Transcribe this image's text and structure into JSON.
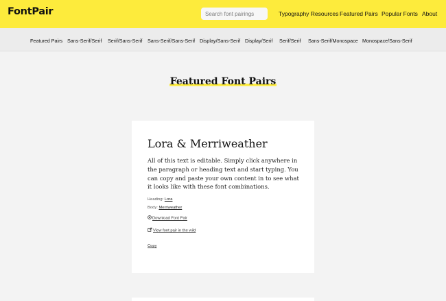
{
  "header": {
    "logo": "FontPair",
    "search_placeholder": "Search font pairings",
    "nav": [
      "Typography Resources",
      "Featured Pairs",
      "Popular Fonts",
      "About"
    ]
  },
  "subnav": {
    "items": [
      "Featured Pairs",
      "Sans-Serif/Serif",
      "Serif/Sans-Serif",
      "Sans-Serif/Sans-Serif",
      "Display/Sans-Serif",
      "Display/Serif",
      "Serif/Serif",
      "Sans-Serif/Monospace",
      "Monospace/Sans-Serif"
    ]
  },
  "main": {
    "title": "Featured Font Pairs",
    "card": {
      "heading": "Lora & Merriweather",
      "body": "All of this text is editable. Simply click anywhere in the paragraph or heading text and start typing. You can copy and paste your own content in to see what it looks like with these font combinations.",
      "heading_label": "Heading:",
      "heading_font": "Lora",
      "body_label": "Body:",
      "body_font": "Merriweather",
      "download_label": "Download Font Pair",
      "wild_label": "View font pair in the wild",
      "copy_label": "Copy"
    }
  },
  "colors": {
    "brand_yellow": "#fdeb3c",
    "background": "#f3f3f3"
  }
}
